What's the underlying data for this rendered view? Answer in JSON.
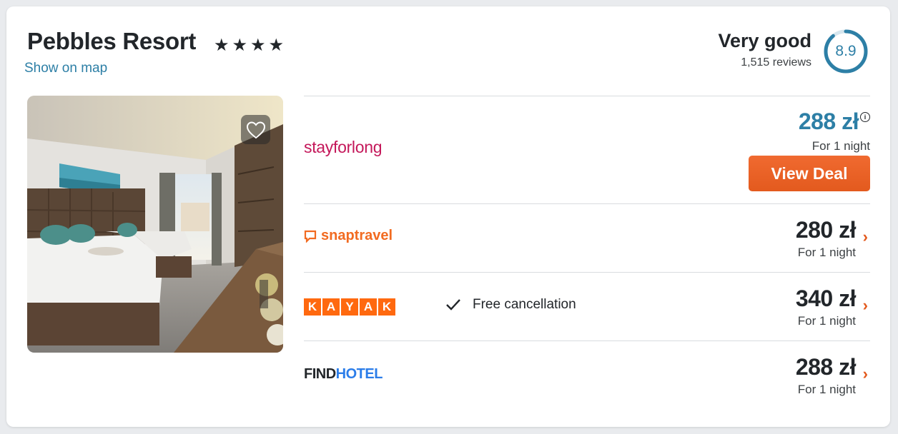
{
  "hotel": {
    "name": "Pebbles Resort",
    "stars": "★★★★",
    "map_link": "Show on map"
  },
  "rating": {
    "label": "Very good",
    "reviews": "1,515 reviews",
    "score": "8.9",
    "score_fraction": 0.89
  },
  "photo": {
    "favorite_icon": "heart-icon"
  },
  "offers": [
    {
      "provider": "stayforlong",
      "price": "288 zł",
      "per_night": "For 1 night",
      "button": "View Deal",
      "info_icon": "i"
    },
    {
      "provider": "snaptravel",
      "price": "280 zł",
      "per_night": "For 1 night"
    },
    {
      "provider": "KAYAK",
      "free_cancellation": "Free cancellation",
      "price": "340 zł",
      "per_night": "For 1 night"
    },
    {
      "provider": "FINDHOTEL",
      "price": "288 zł",
      "per_night": "For 1 night"
    }
  ],
  "colors": {
    "accent_blue": "#2d7fa6",
    "deal_orange": "#e35a1e",
    "stayforlong_pink": "#c4185a",
    "kayak_orange": "#ff690f",
    "findhotel_blue": "#2b7de9"
  }
}
